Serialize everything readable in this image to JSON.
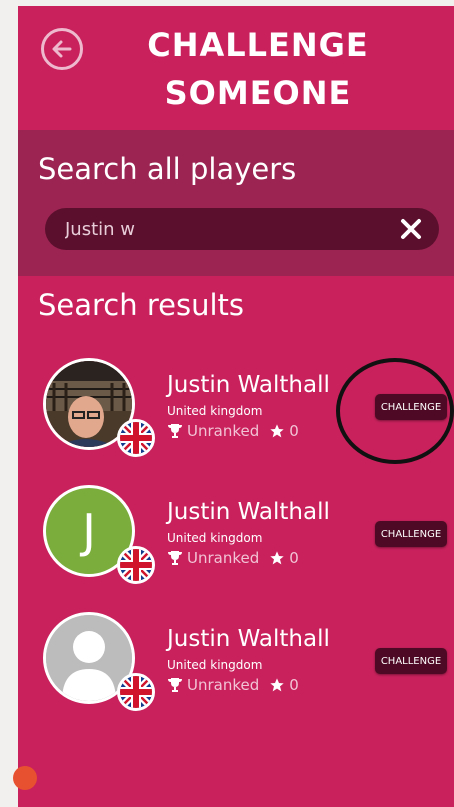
{
  "header": {
    "title_line1": "CHALLENGE",
    "title_line2": "SOMEONE",
    "back_icon": "back-arrow-icon"
  },
  "search": {
    "label": "Search all players",
    "value": "Justin w",
    "clear_icon": "close-icon"
  },
  "results": {
    "title": "Search results",
    "items": [
      {
        "name": "Justin Walthall",
        "country": "United kingdom",
        "rank": "Unranked",
        "stars": "0",
        "avatar": "photo",
        "button": "CHALLENGE"
      },
      {
        "name": "Justin Walthall",
        "country": "United kingdom",
        "rank": "Unranked",
        "stars": "0",
        "avatar": "J",
        "avatar_color": "#7aad3b",
        "button": "CHALLENGE"
      },
      {
        "name": "Justin Walthall",
        "country": "United kingdom",
        "rank": "Unranked",
        "stars": "0",
        "avatar": "placeholder",
        "button": "CHALLENGE"
      }
    ]
  },
  "colors": {
    "background": "#c8215c",
    "panel": "#9b2452",
    "search_box": "#5b0f2c",
    "button": "#4e0a24"
  }
}
